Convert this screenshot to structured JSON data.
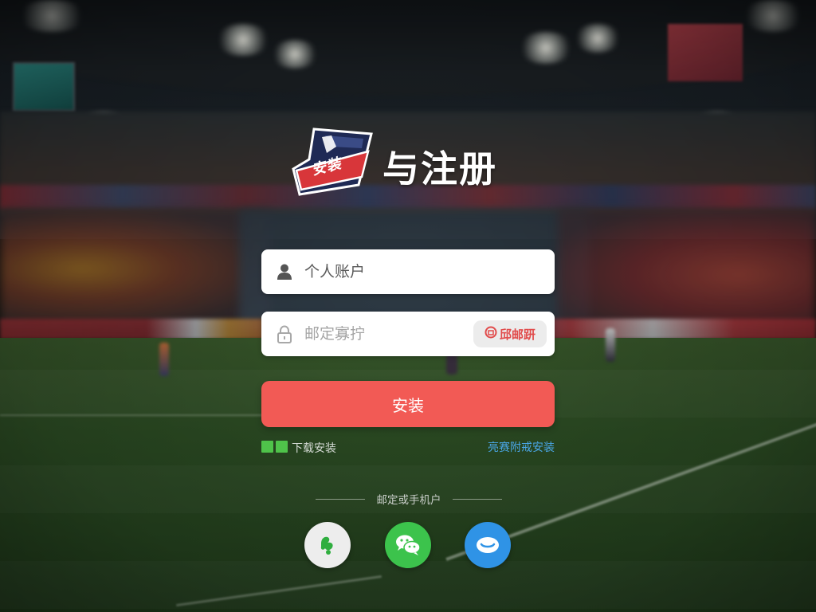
{
  "colors": {
    "accent_red": "#f25a55",
    "link_blue": "#4aa7e8",
    "wechat_green": "#3cc34c",
    "third_party_blue": "#2f93e6",
    "download_green": "#4fc34a"
  },
  "header": {
    "logo_badge": "安装",
    "logo_icon": "shield-logo-icon",
    "title": "与注册"
  },
  "form": {
    "account": {
      "icon": "user-icon",
      "placeholder": "个人账户"
    },
    "password": {
      "icon": "lock-icon",
      "placeholder": "邮定寡拧"
    },
    "code_button": {
      "icon": "mail-circle-icon",
      "label": "邱邮趼"
    },
    "submit_label": "安装"
  },
  "links": {
    "download_text": "下载安装",
    "download_icon": "green-squares-icon",
    "register_text": "亮赛附戒安装"
  },
  "social": {
    "divider_text": "邮定或手机户",
    "buttons": [
      {
        "icon": "green-leaf-icon",
        "color": "#ededed"
      },
      {
        "icon": "wechat-icon",
        "color": "#3cc34c"
      },
      {
        "icon": "chat-bubble-icon",
        "color": "#2f93e6"
      }
    ]
  }
}
